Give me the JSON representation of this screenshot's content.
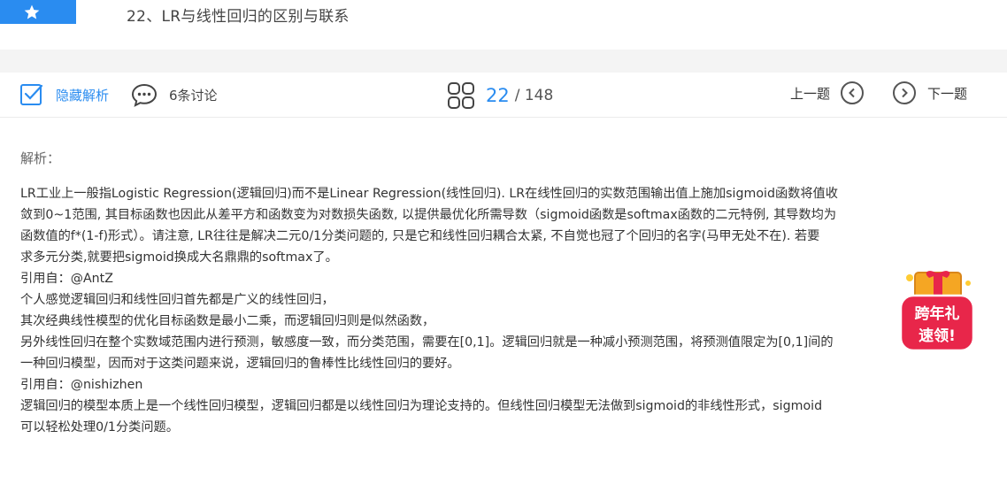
{
  "question": {
    "title": "22、LR与线性回归的区别与联系"
  },
  "toolbar": {
    "hide_analysis_label": "隐藏解析",
    "discussion_label": "6条讨论",
    "current_page": "22",
    "total_pages": "/ 148",
    "prev_label": "上一题",
    "next_label": "下一题"
  },
  "analysis": {
    "heading": "解析：",
    "lines": [
      "LR工业上一般指Logistic Regression(逻辑回归)而不是Linear Regression(线性回归). LR在线性回归的实数范围输出值上施加sigmoid函数将值收",
      "敛到0~1范围, 其目标函数也因此从差平方和函数变为对数损失函数, 以提供最优化所需导数（sigmoid函数是softmax函数的二元特例, 其导数均为",
      "函数值的f*(1-f)形式）。请注意, LR往往是解决二元0/1分类问题的, 只是它和线性回归耦合太紧, 不自觉也冠了个回归的名字(马甲无处不在). 若要",
      "求多元分类,就要把sigmoid换成大名鼎鼎的softmax了。",
      "引用自：@AntZ",
      "个人感觉逻辑回归和线性回归首先都是广义的线性回归，",
      "其次经典线性模型的优化目标函数是最小二乘，而逻辑回归则是似然函数，",
      "另外线性回归在整个实数域范围内进行预测，敏感度一致，而分类范围，需要在[0,1]。逻辑回归就是一种减小预测范围，将预测值限定为[0,1]间的",
      "一种回归模型，因而对于这类问题来说，逻辑回归的鲁棒性比线性回归的要好。",
      "引用自：@nishizhen",
      "逻辑回归的模型本质上是一个线性回归模型，逻辑回归都是以线性回归为理论支持的。但线性回归模型无法做到sigmoid的非线性形式，sigmoid",
      "可以轻松处理0/1分类问题。"
    ]
  },
  "promo": {
    "line1": "跨年礼",
    "line2": "速领!"
  },
  "colors": {
    "accent": "#2a8cf0",
    "promo_red": "#e8264a"
  }
}
